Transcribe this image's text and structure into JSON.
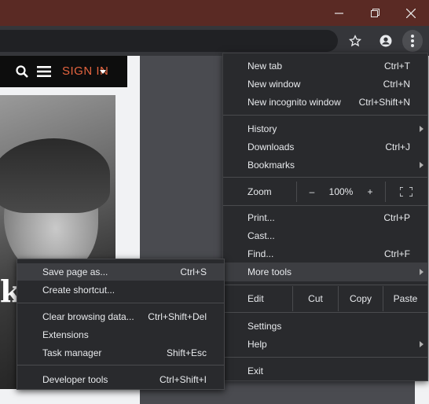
{
  "window_controls": {
    "minimize": "—",
    "restore": "❐",
    "close": "✕"
  },
  "website": {
    "sign_in": "SIGN IN",
    "headline_fragment": "k"
  },
  "menu": {
    "new_tab": {
      "label": "New tab",
      "shortcut": "Ctrl+T"
    },
    "new_window": {
      "label": "New window",
      "shortcut": "Ctrl+N"
    },
    "new_incognito": {
      "label": "New incognito window",
      "shortcut": "Ctrl+Shift+N"
    },
    "history": {
      "label": "History"
    },
    "downloads": {
      "label": "Downloads",
      "shortcut": "Ctrl+J"
    },
    "bookmarks": {
      "label": "Bookmarks"
    },
    "zoom": {
      "label": "Zoom",
      "minus": "–",
      "value": "100%",
      "plus": "+"
    },
    "print": {
      "label": "Print...",
      "shortcut": "Ctrl+P"
    },
    "cast": {
      "label": "Cast..."
    },
    "find": {
      "label": "Find...",
      "shortcut": "Ctrl+F"
    },
    "more_tools": {
      "label": "More tools"
    },
    "edit": {
      "label": "Edit",
      "cut": "Cut",
      "copy": "Copy",
      "paste": "Paste"
    },
    "settings": {
      "label": "Settings"
    },
    "help": {
      "label": "Help"
    },
    "exit": {
      "label": "Exit"
    }
  },
  "submenu": {
    "save_page": {
      "label": "Save page as...",
      "shortcut": "Ctrl+S"
    },
    "create_shortcut": {
      "label": "Create shortcut..."
    },
    "clear_browsing": {
      "label": "Clear browsing data...",
      "shortcut": "Ctrl+Shift+Del"
    },
    "extensions": {
      "label": "Extensions"
    },
    "task_manager": {
      "label": "Task manager",
      "shortcut": "Shift+Esc"
    },
    "developer_tools": {
      "label": "Developer tools",
      "shortcut": "Ctrl+Shift+I"
    }
  },
  "colors": {
    "titlebar": "#5a2a24",
    "menu_bg": "#292a2d",
    "accent_signin": "#e4643f"
  }
}
